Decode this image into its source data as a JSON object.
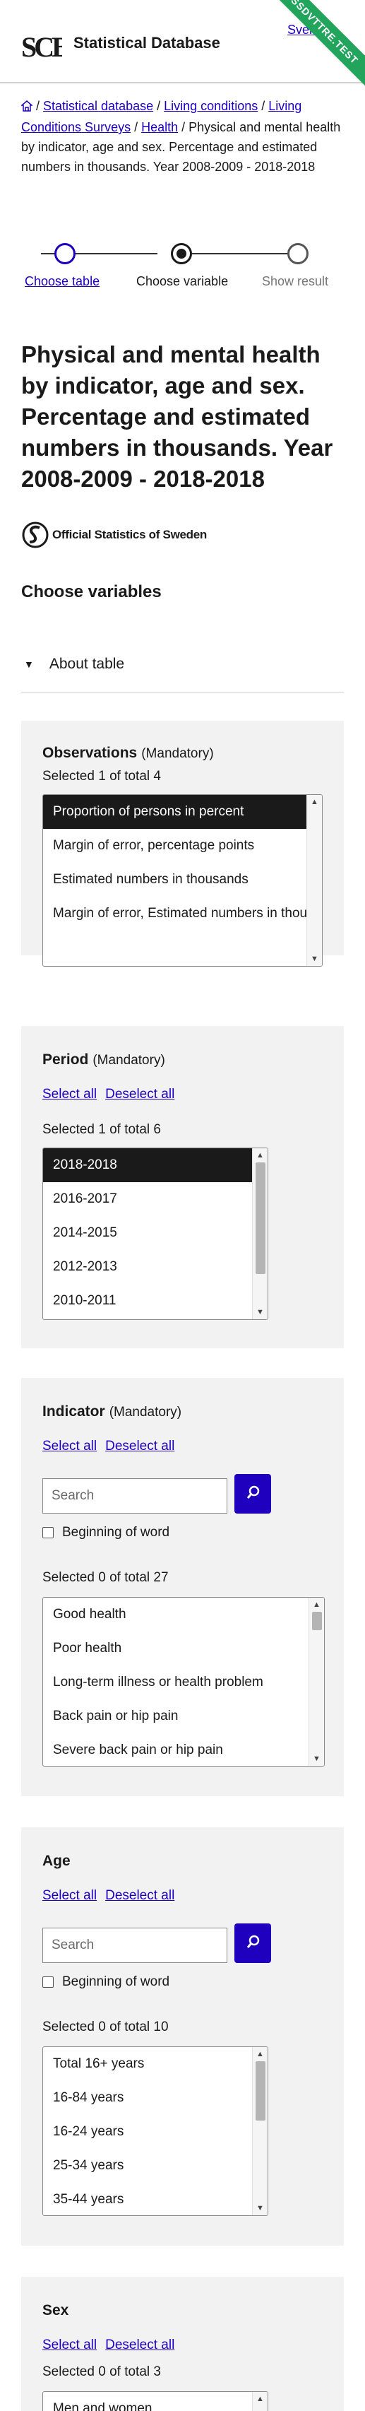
{
  "header": {
    "logo_text": "SCB",
    "title": "Statistical Database",
    "language_link": "Svenska",
    "ribbon": "SSDVTTRE.TEST"
  },
  "breadcrumb": {
    "items": [
      "Statistical database",
      "Living conditions",
      "Living Conditions Surveys",
      "Health"
    ],
    "current": "Physical and mental health by indicator, age and sex. Percentage and estimated numbers in thousands. Year 2008-2009 - 2018-2018",
    "separator": "/"
  },
  "stepper": {
    "steps": [
      {
        "label": "Choose table",
        "state": "done"
      },
      {
        "label": "Choose variable",
        "state": "current"
      },
      {
        "label": "Show result",
        "state": "upcoming"
      }
    ]
  },
  "page": {
    "title": "Physical and mental health by indicator, age and sex. Percentage and estimated numbers in thousands. Year 2008-2009 - 2018-2018",
    "official_label": "Official Statistics of Sweden",
    "choose_heading": "Choose variables",
    "about_label": "About table"
  },
  "common": {
    "mandatory": "(Mandatory)",
    "select_all": "Select all",
    "deselect_all": "Deselect all",
    "search_placeholder": "Search",
    "beginning_of_word": "Beginning of word"
  },
  "observations": {
    "title": "Observations",
    "count": "Selected 1 of total 4",
    "options": [
      "Proportion of persons in percent",
      "Margin of error, percentage points",
      "Estimated numbers in thousands",
      "Margin of error, Estimated numbers in thousands"
    ],
    "selected_index": 0
  },
  "period": {
    "title": "Period",
    "count": "Selected 1 of total 6",
    "options": [
      "2018-2018",
      "2016-2017",
      "2014-2015",
      "2012-2013",
      "2010-2011"
    ],
    "selected_index": 0
  },
  "indicator": {
    "title": "Indicator",
    "count": "Selected 0 of total 27",
    "options": [
      "Good health",
      "Poor health",
      "Long-term illness or health problem",
      "Back pain or hip pain",
      "Severe back pain or hip pain"
    ]
  },
  "age": {
    "title": "Age",
    "count": "Selected 0 of total 10",
    "options": [
      "Total 16+ years",
      "16-84 years",
      "16-24 years",
      "25-34 years",
      "35-44 years"
    ]
  },
  "sex": {
    "title": "Sex",
    "count": "Selected 0 of total 3",
    "options": [
      "Men and women"
    ]
  },
  "colors": {
    "link": "#1e00be",
    "ribbon": "#22a45d",
    "panel": "#f2f2f2",
    "selected_option": "#1a1a1a"
  },
  "icons": [
    "home-icon",
    "search-icon",
    "triangle-down-icon",
    "official-statistics-logo"
  ]
}
